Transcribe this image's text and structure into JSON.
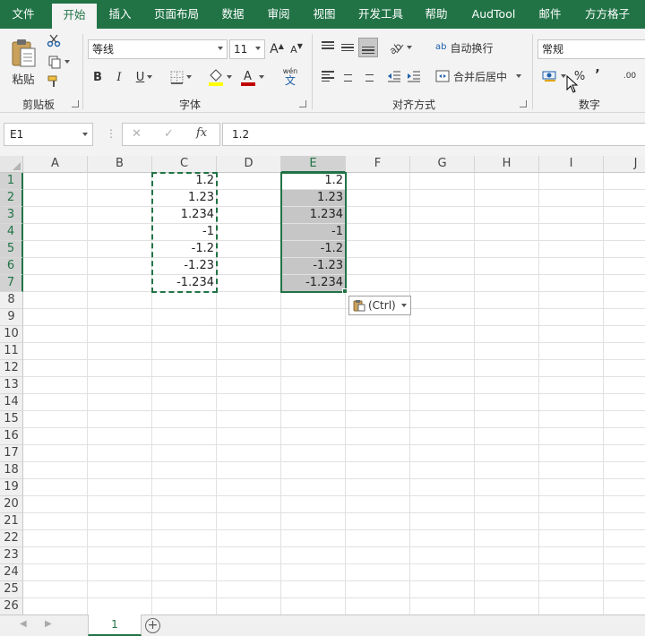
{
  "tabs": [
    {
      "label": "文件",
      "active": false
    },
    {
      "label": "开始",
      "active": true
    },
    {
      "label": "插入",
      "active": false
    },
    {
      "label": "页面布局",
      "active": false
    },
    {
      "label": "数据",
      "active": false
    },
    {
      "label": "审阅",
      "active": false
    },
    {
      "label": "视图",
      "active": false
    },
    {
      "label": "开发工具",
      "active": false
    },
    {
      "label": "帮助",
      "active": false
    },
    {
      "label": "AudTool",
      "active": false
    },
    {
      "label": "邮件",
      "active": false
    },
    {
      "label": "方方格子",
      "active": false
    }
  ],
  "ribbon": {
    "clipboard": {
      "group_label": "剪贴板",
      "paste_label": "粘贴"
    },
    "font": {
      "group_label": "字体",
      "font_name": "等线",
      "font_size": "11",
      "bold": "B",
      "italic": "I",
      "underline": "U",
      "grow": "A",
      "shrink": "A",
      "fill_color": "#ffff00",
      "font_color": "#c00000",
      "phonetic_top": "wén",
      "phonetic_bottom": "文"
    },
    "alignment": {
      "group_label": "对齐方式",
      "wrap_text_icon": "ab",
      "wrap_text": "自动换行",
      "merge_center": "合并后居中"
    },
    "number": {
      "group_label": "数字",
      "format": "常规",
      "percent": "%",
      "comma": "’",
      "increase_decimal": ".00"
    }
  },
  "formula_bar": {
    "name_box": "E1",
    "cancel": "✕",
    "confirm": "✓",
    "fx": "fx",
    "value": "1.2"
  },
  "grid": {
    "columns": [
      "A",
      "B",
      "C",
      "D",
      "E",
      "F",
      "G",
      "H",
      "I",
      "J"
    ],
    "rows": [
      "1",
      "2",
      "3",
      "4",
      "5",
      "6",
      "7",
      "8",
      "9",
      "10",
      "11",
      "12",
      "13",
      "14",
      "15",
      "16",
      "17",
      "18",
      "19",
      "20",
      "21",
      "22",
      "23",
      "24",
      "25",
      "26"
    ],
    "col_c_values": [
      "1.2",
      "1.23",
      "1.234",
      "-1",
      "-1.2",
      "-1.23",
      "-1.234"
    ],
    "col_e_values": [
      "1.2",
      "1.23",
      "1.234",
      "-1",
      "-1.2",
      "-1.23",
      "-1.234"
    ],
    "paste_options": "(Ctrl)",
    "accent_color": "#217346",
    "selected_fill": "#c6c6c6"
  },
  "sheets": {
    "active_sheet": "1",
    "add": "+"
  }
}
